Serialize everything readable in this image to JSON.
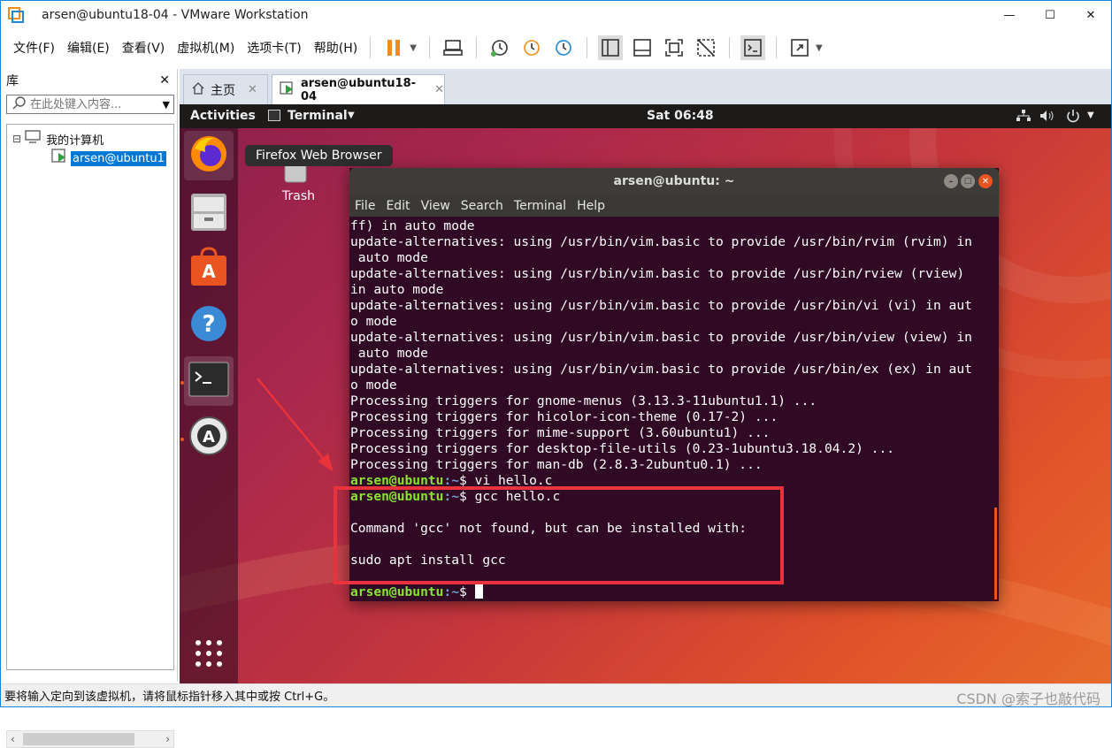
{
  "window": {
    "title": "arsen@ubuntu18-04 - VMware Workstation",
    "minimize": "—",
    "maximize": "☐",
    "close": "✕"
  },
  "menubar": {
    "items": [
      "文件(F)",
      "编辑(E)",
      "查看(V)",
      "虚拟机(M)",
      "选项卡(T)",
      "帮助(H)"
    ]
  },
  "library": {
    "title": "库",
    "close": "✕",
    "search_placeholder": "在此处键入内容...",
    "tree_root": "我的计算机",
    "tree_child": "arsen@ubuntu1",
    "expand_symbol": "⊟"
  },
  "tabs": [
    {
      "label": "主页"
    },
    {
      "label": "arsen@ubuntu18-04"
    }
  ],
  "ubuntu": {
    "activities": "Activities",
    "app_menu": "Terminal",
    "clock": "Sat 06:48",
    "tooltip": "Firefox Web Browser",
    "trash_label": "Trash"
  },
  "terminal": {
    "title": "arsen@ubuntu: ~",
    "menu": [
      "File",
      "Edit",
      "View",
      "Search",
      "Terminal",
      "Help"
    ],
    "lines": [
      "ff) in auto mode",
      "update-alternatives: using /usr/bin/vim.basic to provide /usr/bin/rvim (rvim) in",
      " auto mode",
      "update-alternatives: using /usr/bin/vim.basic to provide /usr/bin/rview (rview)",
      "in auto mode",
      "update-alternatives: using /usr/bin/vim.basic to provide /usr/bin/vi (vi) in aut",
      "o mode",
      "update-alternatives: using /usr/bin/vim.basic to provide /usr/bin/view (view) in",
      " auto mode",
      "update-alternatives: using /usr/bin/vim.basic to provide /usr/bin/ex (ex) in aut",
      "o mode",
      "Processing triggers for gnome-menus (3.13.3-11ubuntu1.1) ...",
      "Processing triggers for hicolor-icon-theme (0.17-2) ...",
      "Processing triggers for mime-support (3.60ubuntu1) ...",
      "Processing triggers for desktop-file-utils (0.23-1ubuntu3.18.04.2) ...",
      "Processing triggers for man-db (2.8.3-2ubuntu0.1) ..."
    ],
    "prompt_user": "arsen@ubuntu",
    "prompt_path": ":~",
    "prompt_sign": "$ ",
    "cmd1": "vi hello.c",
    "cmd2": "gcc hello.c",
    "err1": "Command 'gcc' not found, but can be installed with:",
    "err2": "sudo apt install gcc"
  },
  "statusbar": {
    "text": "要将输入定向到该虚拟机，请将鼠标指针移入其中或按 Ctrl+G。",
    "watermark": "CSDN @索子也敲代码"
  },
  "colors": {
    "highlight_box": "#e8333c",
    "arrow": "#e8333c",
    "terminal_bg": "#300a24",
    "prompt_green": "#8ae234",
    "prompt_blue": "#729fcf"
  }
}
